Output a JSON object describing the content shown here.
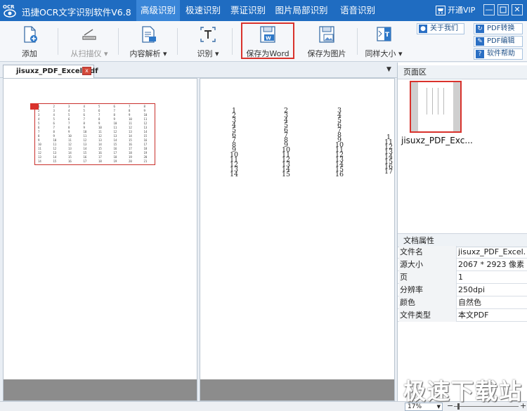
{
  "app": {
    "title": "迅捷OCR文字识别软件V6.8",
    "logo_text": "OCR"
  },
  "tabs": [
    {
      "label": "高级识别",
      "active": true
    },
    {
      "label": "极速识别",
      "active": false
    },
    {
      "label": "票证识别",
      "active": false
    },
    {
      "label": "图片局部识别",
      "active": false
    },
    {
      "label": "语音识别",
      "active": false
    }
  ],
  "vip": {
    "label": "开通VIP"
  },
  "window_controls": {
    "minimize": "—",
    "close": "✕"
  },
  "toolbar": {
    "add": "添加",
    "scanner": "从扫描仪",
    "content_parse": "内容解析",
    "recognize": "识别",
    "save_word": "保存为Word",
    "save_image": "保存为图片",
    "same_size": "同样大小"
  },
  "side_buttons": {
    "about": "关于我们",
    "pdf_convert": "PDF转换",
    "pdf_edit": "PDF编辑",
    "help": "软件帮助"
  },
  "document": {
    "tab_name": "jisuxz_PDF_Excel.pdf",
    "close_icon": "x",
    "menu_arrow": "▼"
  },
  "original_table": {
    "rows": [
      [
        "1",
        "2",
        "3",
        "4",
        "5",
        "6",
        "7",
        "8"
      ],
      [
        "2",
        "3",
        "4",
        "5",
        "6",
        "7",
        "8",
        "9"
      ],
      [
        "3",
        "4",
        "5",
        "6",
        "7",
        "8",
        "9",
        "10"
      ],
      [
        "4",
        "5",
        "6",
        "7",
        "8",
        "9",
        "10",
        "11"
      ],
      [
        "5",
        "6",
        "7",
        "8",
        "9",
        "10",
        "11",
        "12"
      ],
      [
        "6",
        "7",
        "8",
        "9",
        "10",
        "11",
        "12",
        "13"
      ],
      [
        "7",
        "8",
        "9",
        "10",
        "11",
        "12",
        "13",
        "14"
      ],
      [
        "8",
        "9",
        "10",
        "11",
        "12",
        "13",
        "14",
        "15"
      ],
      [
        "9",
        "10",
        "11",
        "12",
        "13",
        "14",
        "15",
        "16"
      ],
      [
        "10",
        "11",
        "12",
        "13",
        "14",
        "15",
        "16",
        "17"
      ],
      [
        "11",
        "12",
        "13",
        "14",
        "15",
        "16",
        "17",
        "18"
      ],
      [
        "12",
        "13",
        "14",
        "15",
        "16",
        "17",
        "18",
        "19"
      ],
      [
        "13",
        "14",
        "15",
        "16",
        "17",
        "18",
        "19",
        "20"
      ],
      [
        "14",
        "15",
        "16",
        "17",
        "18",
        "19",
        "20",
        "21"
      ]
    ]
  },
  "recognized_columns": [
    [
      "1",
      "2",
      "3",
      "4",
      "5",
      "6",
      "7",
      "8",
      "9",
      "10",
      "11",
      "12",
      "13",
      "14"
    ],
    [
      "2",
      "3",
      "4",
      "5",
      "6",
      "7",
      "8",
      "9",
      "10",
      "11",
      "12",
      "13",
      "14",
      "15"
    ],
    [
      "3",
      "4",
      "5",
      "6",
      "7",
      "8",
      "9",
      "10",
      "11",
      "12",
      "13",
      "14",
      "15",
      "16"
    ],
    [
      "1",
      "11",
      "12",
      "13",
      "14",
      "15",
      "16",
      "17"
    ]
  ],
  "page_panel": {
    "title": "页面区",
    "thumb_label": "jisuxz_PDF_Exc..."
  },
  "doc_props": {
    "title": "文档属性",
    "rows": [
      {
        "key": "文件名",
        "value": "jisuxz_PDF_Excel..."
      },
      {
        "key": "源大小",
        "value": "2067 * 2923 像素"
      },
      {
        "key": "页",
        "value": "1"
      },
      {
        "key": "分辨率",
        "value": "250dpi"
      },
      {
        "key": "颜色",
        "value": "自然色"
      },
      {
        "key": "文件类型",
        "value": "本文PDF"
      }
    ]
  },
  "status": {
    "zoom": "17%",
    "zoom_minus": "−",
    "zoom_plus": "+"
  },
  "watermark": "极速下载站"
}
